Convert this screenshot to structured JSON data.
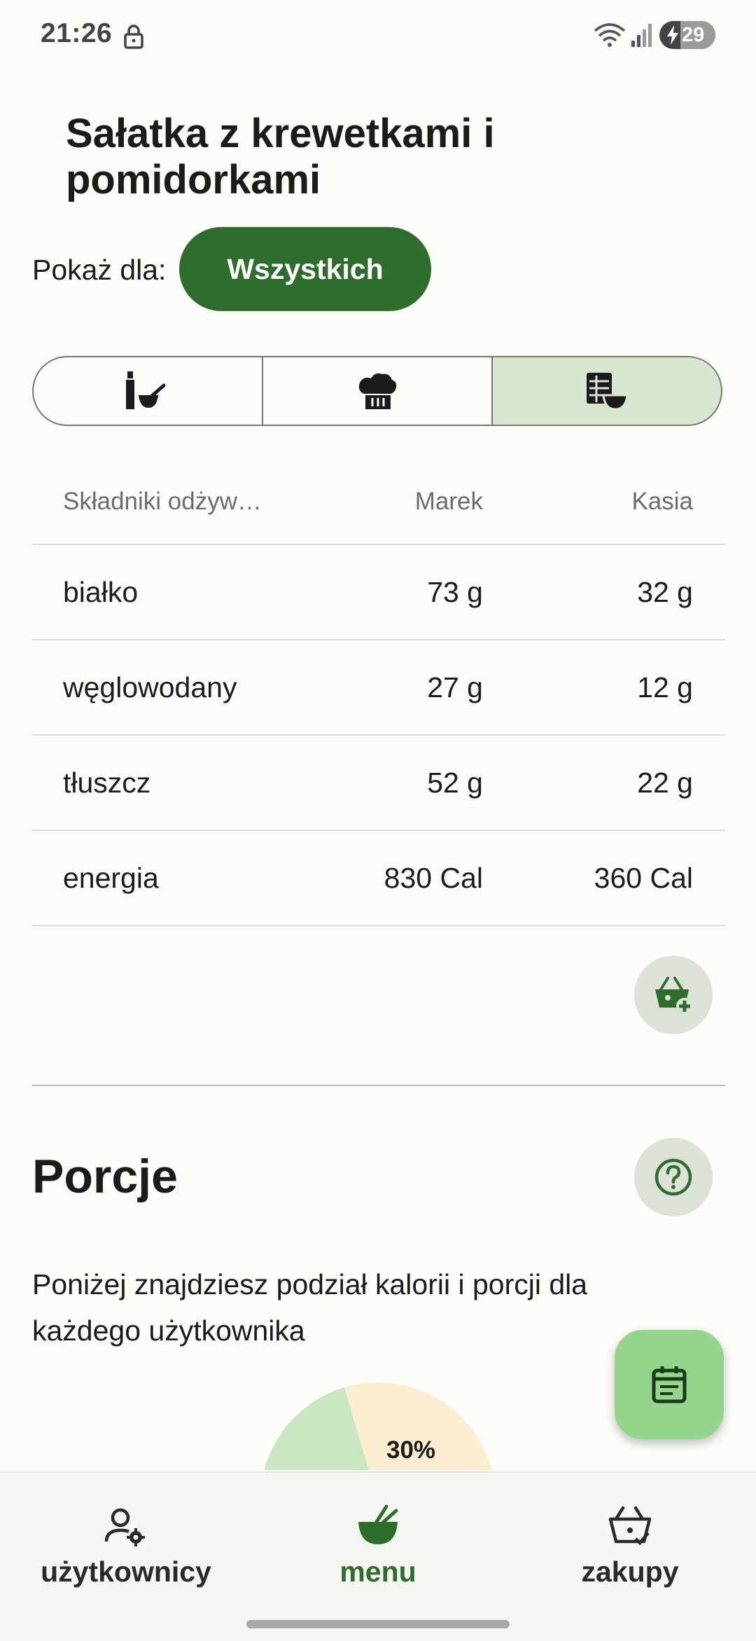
{
  "status_bar": {
    "time": "21:26",
    "battery_level": "29",
    "icons": [
      "lock-icon",
      "wifi-icon",
      "signal-icon",
      "battery-charging-icon"
    ]
  },
  "recipe": {
    "title": "Sałatka z krewetkami i pomidorkami",
    "show_for_label": "Pokaż dla:",
    "show_for_value": "Wszystkich"
  },
  "tabs": [
    {
      "icon": "ingredients-icon",
      "active": false
    },
    {
      "icon": "chef-hat-icon",
      "active": false
    },
    {
      "icon": "nutrition-table-icon",
      "active": true
    }
  ],
  "nutrition_table": {
    "headers": [
      "Składniki odżyw…",
      "Marek",
      "Kasia"
    ],
    "rows": [
      [
        "białko",
        "73 g",
        "32 g"
      ],
      [
        "węglowodany",
        "27 g",
        "12 g"
      ],
      [
        "tłuszcz",
        "52 g",
        "22 g"
      ],
      [
        "energia",
        "830 Cal",
        "360 Cal"
      ]
    ]
  },
  "portions": {
    "title": "Porcje",
    "description": "Poniżej znajdziesz podział kalorii i porcji dla każdego użytkownika",
    "chart_label": "30%",
    "colors": {
      "green": "#c8e6c0",
      "peach": "#fcecd0"
    }
  },
  "bottom_nav": [
    {
      "label": "użytkownicy",
      "icon": "user-settings-icon",
      "active": false
    },
    {
      "label": "menu",
      "icon": "bowl-icon",
      "active": true
    },
    {
      "label": "zakupy",
      "icon": "basket-check-icon",
      "active": false
    }
  ],
  "colors": {
    "primary": "#2f6d2d",
    "fab": "#93d58a",
    "tab_active": "#d8e6d0"
  }
}
